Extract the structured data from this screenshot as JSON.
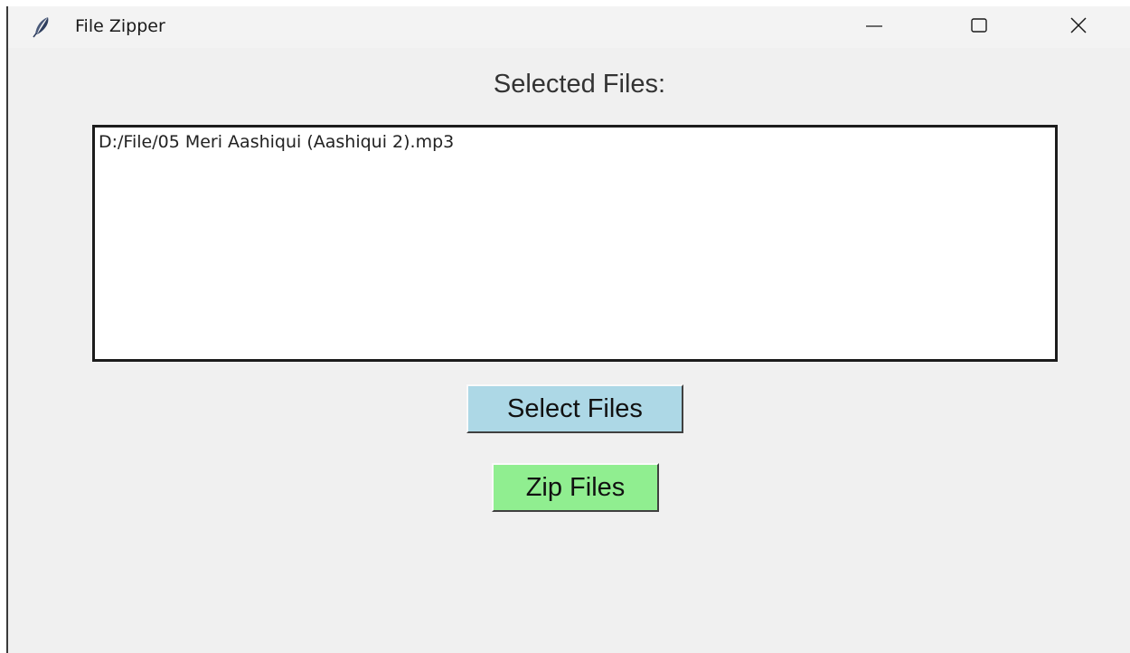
{
  "window": {
    "title": "File Zipper",
    "icon": "feather-icon",
    "controls": {
      "minimize_icon": "minimize-icon",
      "maximize_icon": "maximize-icon",
      "close_icon": "close-icon"
    }
  },
  "main": {
    "heading": "Selected Files:",
    "files": [
      "D:/File/05 Meri Aashiqui (Aashiqui 2).mp3"
    ],
    "select_button_label": "Select Files",
    "zip_button_label": "Zip Files"
  },
  "colors": {
    "background": "#f0f0f0",
    "select_button": "#add8e6",
    "zip_button": "#90ee90",
    "listbox_background": "#ffffff",
    "listbox_border": "#1c1c1c"
  }
}
